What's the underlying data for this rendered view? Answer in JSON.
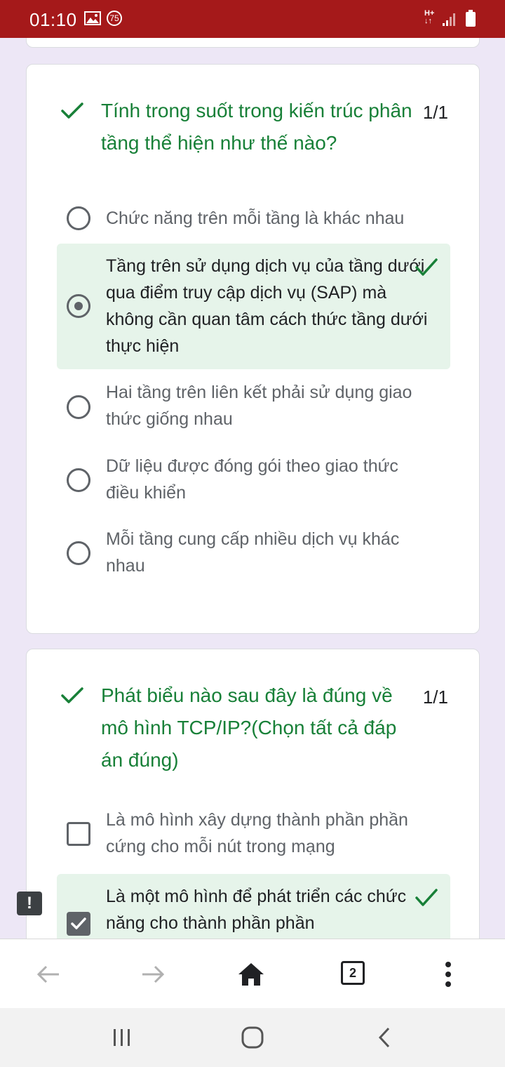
{
  "status_bar": {
    "time": "01:10",
    "badge": "75",
    "network_top": "H+",
    "network_bottom": "↓↑",
    "icons": [
      "image-icon",
      "signal-icon",
      "battery-icon"
    ]
  },
  "questions": [
    {
      "title": "Tính trong suốt trong kiến trúc phân tầng thể hiện như thế nào?",
      "score": "1/1",
      "type": "radio",
      "options": [
        {
          "text": "Chức năng trên mỗi tầng là khác nhau",
          "selected": false,
          "correct": false
        },
        {
          "text": "Tầng trên sử dụng dịch vụ của tầng dưới qua điểm truy cập dịch vụ (SAP) mà không cần quan tâm cách thức tầng dưới thực hiện",
          "selected": true,
          "correct": true
        },
        {
          "text": "Hai tầng trên liên kết phải sử dụng giao thức giống nhau",
          "selected": false,
          "correct": false
        },
        {
          "text": "Dữ liệu được đóng gói theo giao thức điều khiển",
          "selected": false,
          "correct": false
        },
        {
          "text": "Mỗi tầng cung cấp nhiều dịch vụ khác nhau",
          "selected": false,
          "correct": false
        }
      ]
    },
    {
      "title": "Phát biểu nào sau đây là đúng về mô hình TCP/IP?(Chọn tất cả đáp án đúng)",
      "score": "1/1",
      "type": "checkbox",
      "options": [
        {
          "text": "Là mô hình xây dựng thành phần phần cứng cho mỗi nút trong mạng",
          "selected": false,
          "correct": false
        },
        {
          "text": "Là một mô hình để phát triển các chức năng cho thành phần phần",
          "selected": true,
          "correct": true
        }
      ]
    }
  ],
  "warning_badge": "!",
  "browser_bar": {
    "tab_count": "2",
    "icons": [
      "back-arrow-icon",
      "forward-arrow-icon",
      "home-icon",
      "tab-switcher-icon",
      "more-menu-icon"
    ]
  },
  "colors": {
    "status_bar": "#a5191a",
    "correct_green": "#188038",
    "correct_bg": "#e6f4ea",
    "page_bg": "#ede7f6"
  }
}
